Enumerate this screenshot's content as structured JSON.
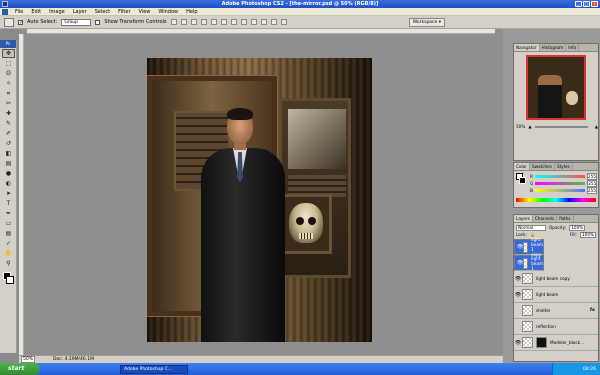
{
  "window": {
    "title": "Adobe Photoshop CS2 - [the-mirror.psd @ 50% (RGB/8)]",
    "min": "_",
    "max": "□",
    "close": "x"
  },
  "menu": [
    "File",
    "Edit",
    "Image",
    "Layer",
    "Select",
    "Filter",
    "View",
    "Window",
    "Help"
  ],
  "options": {
    "auto_select_label": "Auto Select:",
    "auto_select_value": "Group",
    "show_transform_label": "Show Transform Controls",
    "workspace_label": "Workspace ▾"
  },
  "toolbox": {
    "tools": [
      "move-tool",
      "marquee-tool",
      "lasso-tool",
      "magic-wand-tool",
      "crop-tool",
      "slice-tool",
      "healing-brush-tool",
      "brush-tool",
      "clone-stamp-tool",
      "history-brush-tool",
      "eraser-tool",
      "gradient-tool",
      "blur-tool",
      "dodge-tool",
      "path-selection-tool",
      "type-tool",
      "pen-tool",
      "shape-tool",
      "notes-tool",
      "eyedropper-tool",
      "hand-tool",
      "zoom-tool"
    ],
    "glyphs": [
      "✥",
      "⬚",
      "ʘ",
      "✧",
      "⌗",
      "✂",
      "✚",
      "✎",
      "✐",
      "↺",
      "◧",
      "▤",
      "●",
      "◐",
      "➤",
      "T",
      "✒",
      "▭",
      "▤",
      "✓",
      "✋",
      "⚲"
    ]
  },
  "status": {
    "zoom": "50%",
    "doc": "Doc: 4.19M/46.1M"
  },
  "navigator": {
    "tabs": [
      "Navigator",
      "Histogram",
      "Info"
    ],
    "zoom": "50%"
  },
  "color": {
    "tabs": [
      "Color",
      "Swatches",
      "Styles"
    ],
    "rows": [
      {
        "label": "R",
        "value": "255",
        "color": "#ff5050"
      },
      {
        "label": "G",
        "value": "255",
        "color": "#50c050"
      },
      {
        "label": "B",
        "value": "255",
        "color": "#5070ff"
      }
    ]
  },
  "layers": {
    "tabs": [
      "Layers",
      "Channels",
      "Paths"
    ],
    "blend_mode": "Normal",
    "opacity_label": "Opacity:",
    "opacity": "100%",
    "lock_label": "Lock:",
    "fill_label": "Fill:",
    "fill": "100%",
    "items": [
      {
        "name": "light beam 1 copy",
        "visible": true,
        "selected": true,
        "fx": false
      },
      {
        "name": "light beam 1",
        "visible": true,
        "selected": true,
        "fx": false
      },
      {
        "name": "light beam copy",
        "visible": true,
        "selected": false,
        "fx": false
      },
      {
        "name": "light beam",
        "visible": true,
        "selected": false,
        "fx": false
      },
      {
        "name": "shelter",
        "visible": false,
        "selected": false,
        "fx": true
      },
      {
        "name": "reflection",
        "visible": false,
        "selected": false,
        "fx": false
      },
      {
        "name": "Modeler_block...",
        "visible": true,
        "selected": false,
        "fx": false
      }
    ]
  },
  "taskbar": {
    "start": "start",
    "task": "Adobe Photoshop C...",
    "clock": "08:26"
  },
  "colors": {
    "title_blue": "#245ed8",
    "selection": "#3a6ad8",
    "chrome": "#d4d0c8"
  }
}
